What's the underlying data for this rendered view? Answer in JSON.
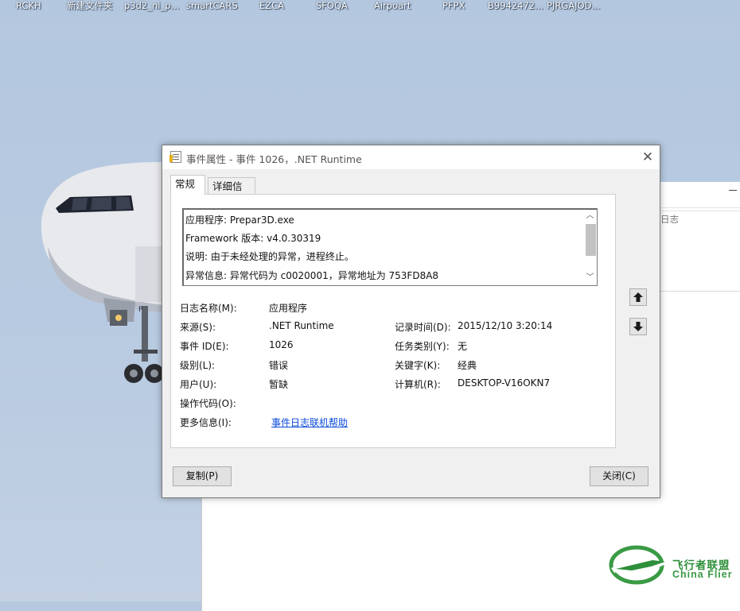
{
  "desktop": {
    "icons": [
      "RCKH",
      "新建文件夹",
      "p3d2_ni_p...",
      "smartCARS",
      "EZCA",
      "SFOQA",
      "Airpoart",
      "PFPX",
      "B9942472...",
      "PJRGAJOD..."
    ]
  },
  "background_window": {
    "log_label": "日志"
  },
  "dialog": {
    "title": "事件属性 - 事件 1026，.NET Runtime",
    "tabs": [
      "常规",
      "详细信息"
    ],
    "description_lines": [
      "应用程序: Prepar3D.exe",
      "Framework 版本: v4.0.30319",
      "说明: 由于未经处理的异常，进程终止。",
      "异常信息: 异常代码为 c0020001，异常地址为 753FD8A8"
    ],
    "fields": {
      "log_name_label": "日志名称(M):",
      "log_name_value": "应用程序",
      "source_label": "来源(S):",
      "source_value": ".NET Runtime",
      "logged_label": "记录时间(D):",
      "logged_value": "2015/12/10 3:20:14",
      "event_id_label": "事件 ID(E):",
      "event_id_value": "1026",
      "task_label": "任务类别(Y):",
      "task_value": "无",
      "level_label": "级别(L):",
      "level_value": "错误",
      "keywords_label": "关键字(K):",
      "keywords_value": "经典",
      "user_label": "用户(U):",
      "user_value": "暂缺",
      "computer_label": "计算机(R):",
      "computer_value": "DESKTOP-V16OKN7",
      "opcode_label": "操作代码(O):",
      "opcode_value": "",
      "more_info_label": "更多信息(I):",
      "more_info_link": "事件日志联机帮助"
    },
    "buttons": {
      "copy": "复制(P)",
      "close": "关闭(C)"
    }
  },
  "watermark": {
    "cn": "飞行者联盟",
    "en": "China Flier"
  }
}
